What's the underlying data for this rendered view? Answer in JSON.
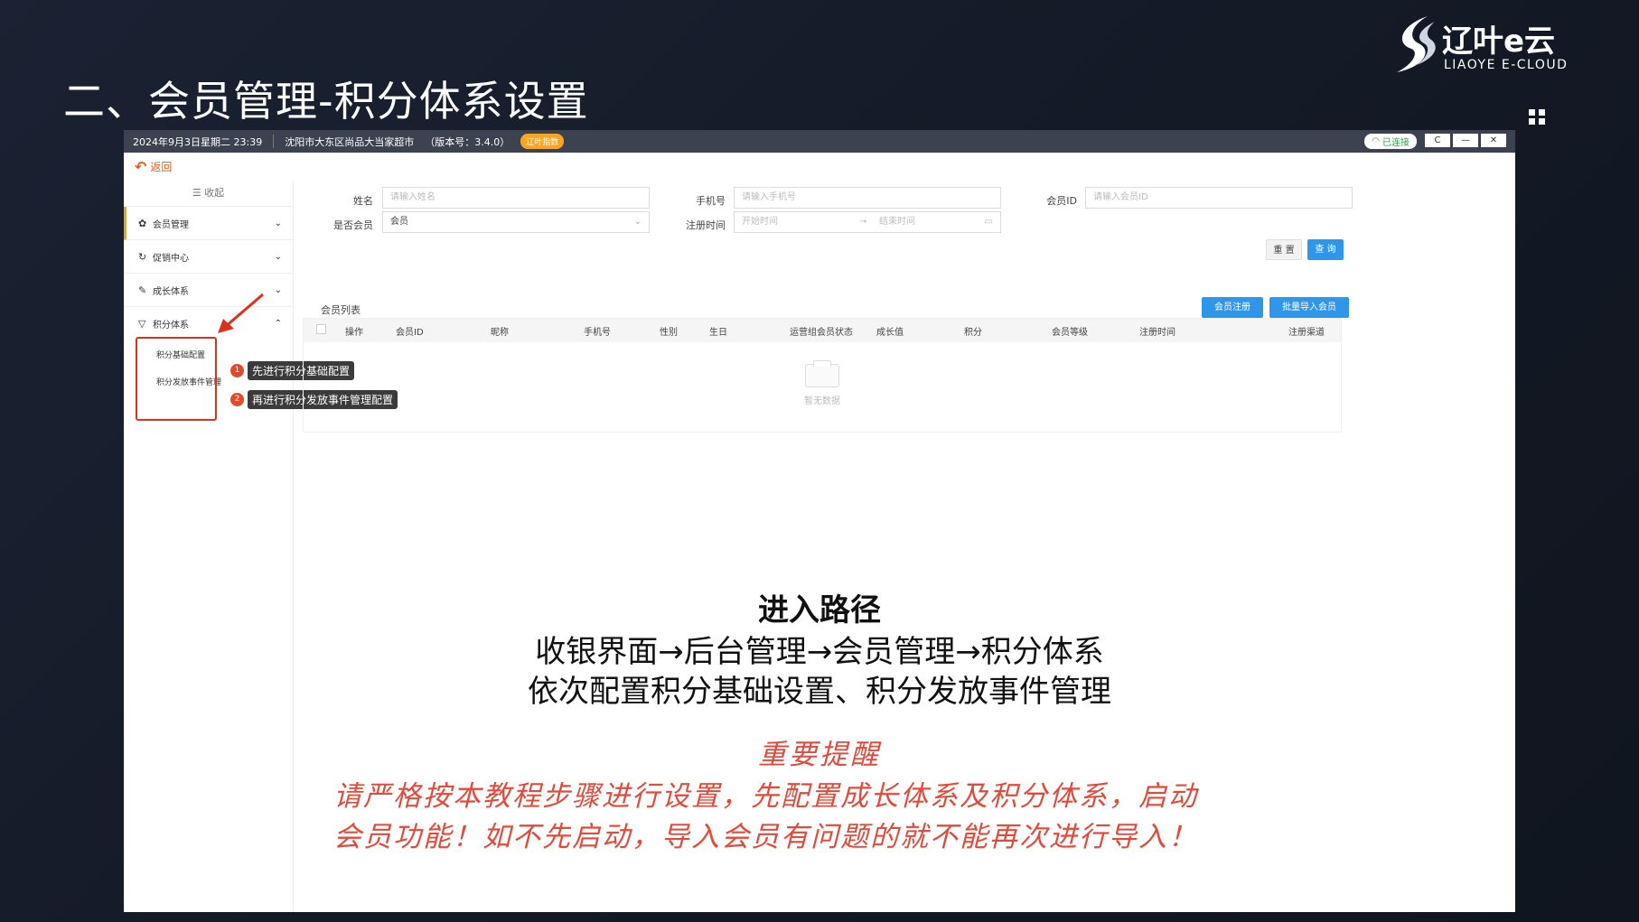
{
  "slide": {
    "title": "二、会员管理-积分体系设置",
    "logo_cn": "辽叶e云",
    "logo_en": "LIAOYE E-CLOUD"
  },
  "titlebar": {
    "datetime": "2024年9月3日星期二 23:39",
    "store": "沈阳市大东区尚品大当家超市",
    "version": "（版本号：3.4.0）",
    "badge": "辽叶指数",
    "connection": "已连接",
    "refresh": "C",
    "minimize": "—",
    "close": "✕"
  },
  "back": {
    "label": "返回"
  },
  "sidebar": {
    "collapse": "收起",
    "items": [
      {
        "label": "会员管理",
        "icon": "gear-icon",
        "glyph": "✿",
        "chevron": "⌄"
      },
      {
        "label": "促销中心",
        "icon": "refresh-icon",
        "glyph": "↻",
        "chevron": "⌄"
      },
      {
        "label": "成长体系",
        "icon": "tag-icon",
        "glyph": "✎",
        "chevron": "⌄"
      },
      {
        "label": "积分体系",
        "icon": "filter-icon",
        "glyph": "▽",
        "chevron": "⌃"
      }
    ],
    "subitems": [
      {
        "label": "积分基础配置"
      },
      {
        "label": "积分发放事件管理"
      }
    ]
  },
  "steps": [
    {
      "num": "1",
      "tip": "先进行积分基础配置"
    },
    {
      "num": "2",
      "tip": "再进行积分发放事件管理配置"
    }
  ],
  "form": {
    "name_label": "姓名",
    "name_placeholder": "请输入姓名",
    "phone_label": "手机号",
    "phone_placeholder": "请输入手机号",
    "id_label": "会员ID",
    "id_placeholder": "请输入会员ID",
    "member_label": "是否会员",
    "member_value": "会员",
    "regtime_label": "注册时间",
    "start_placeholder": "开始时间",
    "end_placeholder": "结束时间",
    "reset": "重 置",
    "query": "查 询"
  },
  "list": {
    "title": "会员列表",
    "register": "会员注册",
    "import": "批量导入会员",
    "columns": [
      "操作",
      "会员ID",
      "昵称",
      "手机号",
      "性别",
      "生日",
      "运营组会员状态",
      "成长值",
      "积分",
      "会员等级",
      "注册时间",
      "注册渠道"
    ],
    "empty": "暂无数据"
  },
  "notes": {
    "path_title": "进入路径",
    "path_line1": "收银界面→后台管理→会员管理→积分体系",
    "path_line2": "依次配置积分基础设置、积分发放事件管理",
    "reminder_title": "重要提醒",
    "reminder_line1": "请严格按本教程步骤进行设置，先配置成长体系及积分体系，启动",
    "reminder_line2": "会员功能！如不先启动，导入会员有问题的就不能再次进行导入！"
  },
  "colors": {
    "accent_orange": "#e65c1f",
    "annotation_red": "#d9331f",
    "primary_blue": "#2f96ea",
    "reminder_red": "#e24b3b"
  }
}
